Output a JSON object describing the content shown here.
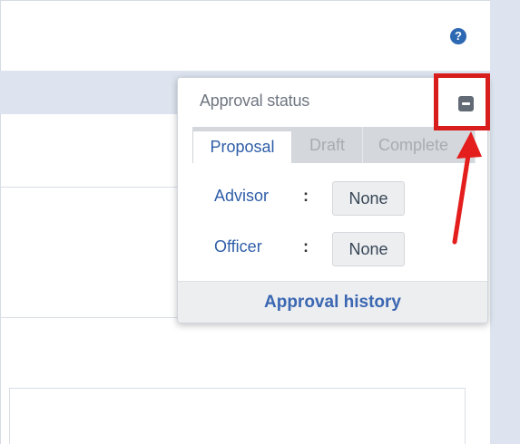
{
  "topbar": {
    "help_icon": "question-circle",
    "help_glyph": "?"
  },
  "approval_panel": {
    "title": "Approval status",
    "collapse_icon": "minus-square",
    "tabs": [
      {
        "label": "Proposal",
        "active": true
      },
      {
        "label": "Draft",
        "active": false
      },
      {
        "label": "Complete",
        "active": false
      }
    ],
    "fields": [
      {
        "label": "Advisor",
        "separator": ":",
        "value": "None"
      },
      {
        "label": "Officer",
        "separator": ":",
        "value": "None"
      }
    ],
    "history_link": "Approval history"
  },
  "annotation": {
    "highlight_color": "#d81d1d",
    "arrow_color": "#e41d1d"
  },
  "colors": {
    "primary_text": "#2f5ea8",
    "header_strip": "#dde4ef",
    "muted_tab": "#a8adb3"
  }
}
